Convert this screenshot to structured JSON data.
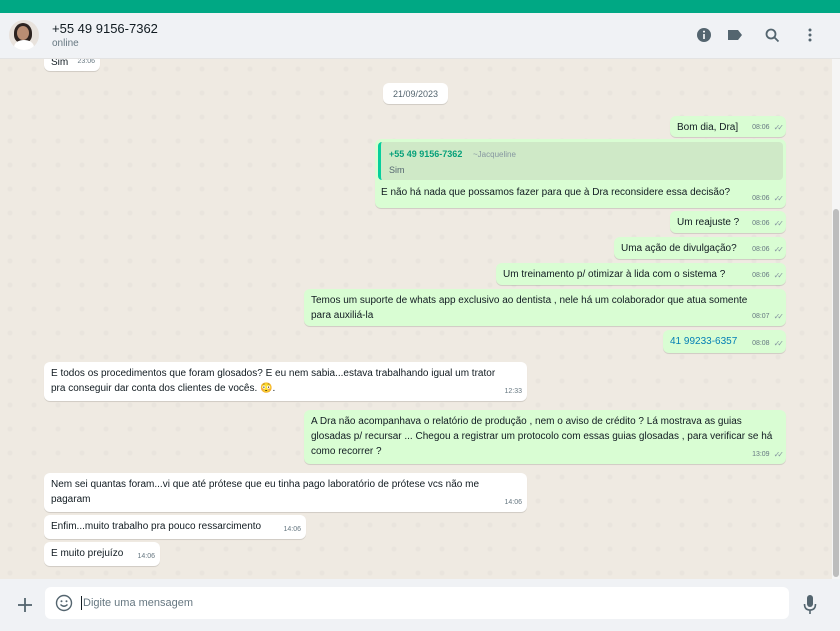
{
  "header": {
    "contact_name": "+55 49 9156-7362",
    "status": "online",
    "icons": [
      "info-icon",
      "label-icon",
      "search-icon",
      "menu-icon"
    ]
  },
  "chat": {
    "partial_message": {
      "text": "Sim",
      "time": "23:06"
    },
    "date_chip": "21/09/2023",
    "messages": [
      {
        "text": "Bom dia, Dra]",
        "time": "08:06"
      },
      {
        "quote_name": "+55 49 9156-7362",
        "quote_alias": "~Jacqueline",
        "quote_text": "Sim",
        "text": "E não há nada que possamos fazer para que à Dra reconsidere essa decisão?",
        "time": "08:06"
      },
      {
        "text": "Um reajuste ?",
        "time": "08:06"
      },
      {
        "text": "Uma ação de divulgação?",
        "time": "08:06"
      },
      {
        "text": "Um treinamento p/ otimizar à lida com o sistema ?",
        "time": "08:06"
      },
      {
        "text": "Temos um suporte de whats app exclusivo ao dentista , nele há um colaborador que atua somente para auxiliá-la",
        "time": "08:07"
      },
      {
        "text": "41 99233-6357",
        "time": "08:08"
      },
      {
        "text": "E todos os procedimentos que foram glosados? E eu nem sabia...estava trabalhando igual um trator pra conseguir dar conta dos clientes de vocês. ",
        "emoji": "😳",
        "tail": ".",
        "time": "12:33"
      },
      {
        "text": "A Dra não acompanhava o relatório de produção , nem o aviso de crédito ? Lá mostrava as guias glosadas p/ recursar ... Chegou a registrar um protocolo com essas guias glosadas , para verificar se há como recorrer ?",
        "time": "13:09"
      },
      {
        "text": "Nem sei quantas foram...vi que até prótese que eu tinha pago laboratório de prótese vcs não me pagaram",
        "time": "14:06"
      },
      {
        "text": "Enfim...muito trabalho pra pouco ressarcimento",
        "time": "14:06"
      },
      {
        "text": "E muito prejuízo",
        "time": "14:06"
      }
    ]
  },
  "footer": {
    "placeholder": "Digite uma mensagem"
  },
  "colors": {
    "accent": "#00a884",
    "outgoing_bubble": "#d9fdd3",
    "incoming_bubble": "#ffffff",
    "chat_background": "#efeae2",
    "link": "#027eb5"
  }
}
